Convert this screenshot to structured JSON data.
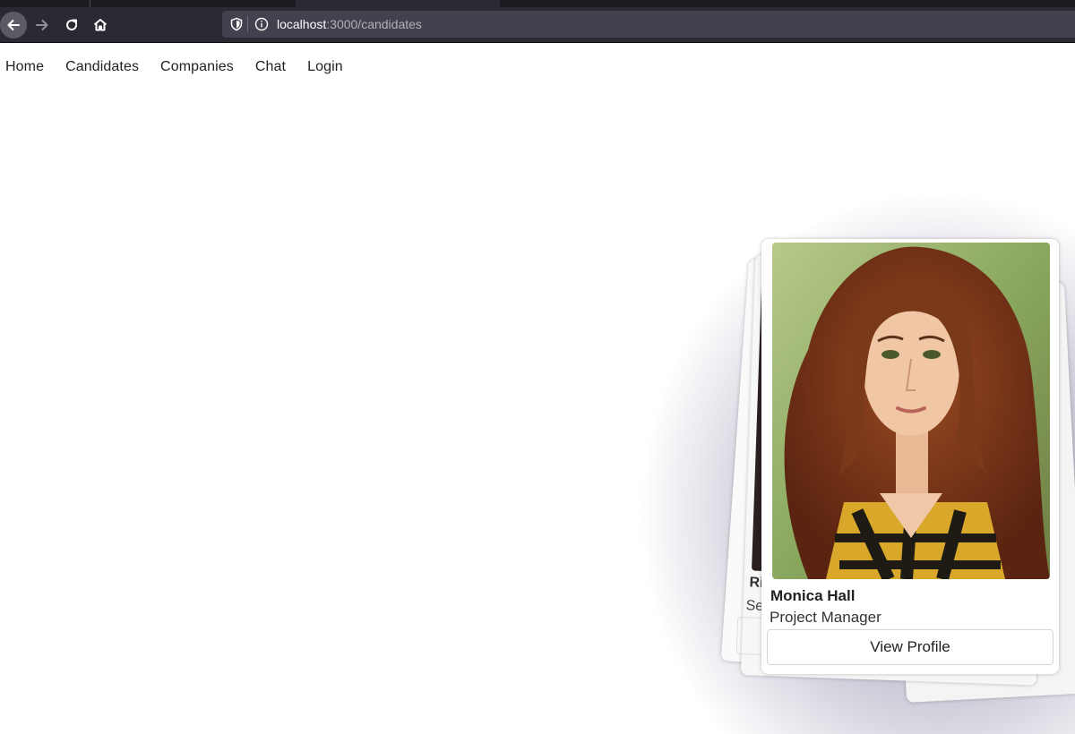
{
  "browser": {
    "url_host": "localhost",
    "url_path": ":3000/candidates"
  },
  "nav": {
    "items": [
      "Home",
      "Candidates",
      "Companies",
      "Chat",
      "Login"
    ]
  },
  "candidate_card": {
    "name": "Monica Hall",
    "role": "Project Manager",
    "button_label": "View Profile"
  },
  "background_card": {
    "name_fragment": "Ri",
    "role_fragment": "Se"
  },
  "icons": [
    "back-arrow-icon",
    "forward-arrow-icon",
    "reload-icon",
    "home-icon",
    "shield-icon",
    "info-icon"
  ]
}
